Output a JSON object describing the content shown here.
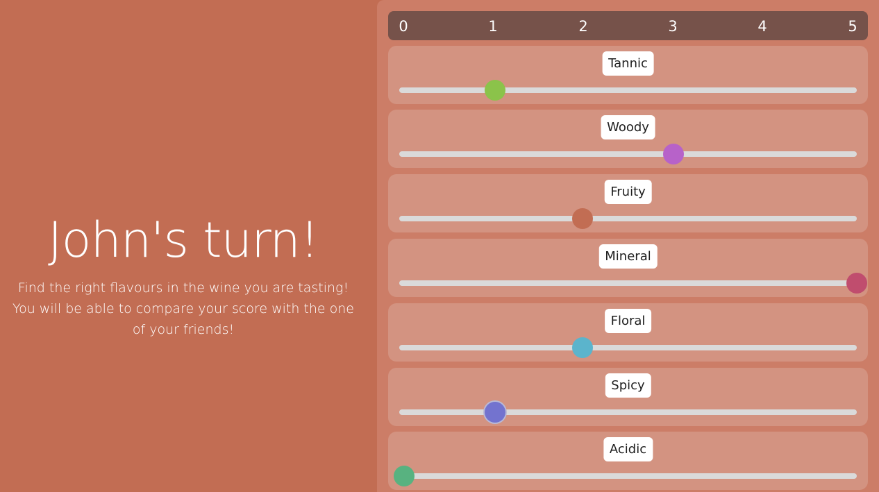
{
  "intro": {
    "title": "John's turn!",
    "line1": "Find the right flavours in the wine you are tasting!",
    "line2": "You will be able to compare your score with the one of your friends!"
  },
  "scale": {
    "min": 0,
    "max": 5,
    "ticks": [
      "0",
      "1",
      "2",
      "3",
      "4",
      "5"
    ]
  },
  "sliders": [
    {
      "label": "Tannic",
      "value": 1.05,
      "color": "#8bc34a",
      "focused": false
    },
    {
      "label": "Woody",
      "value": 3.0,
      "color": "#b762c9",
      "focused": false
    },
    {
      "label": "Fruity",
      "value": 2.0,
      "color": "#c26d53",
      "focused": false
    },
    {
      "label": "Mineral",
      "value": 5.0,
      "color": "#c04d6e",
      "focused": false
    },
    {
      "label": "Floral",
      "value": 2.0,
      "color": "#5bb4cc",
      "focused": false
    },
    {
      "label": "Spicy",
      "value": 1.05,
      "color": "#7373cf",
      "focused": true
    },
    {
      "label": "Acidic",
      "value": 0.05,
      "color": "#58b280",
      "focused": false
    }
  ],
  "colors": {
    "background": "#c26d53",
    "panel": "#cc7d67",
    "card": "#d39381",
    "scale_bar": "#76524a",
    "track": "#dadada"
  }
}
